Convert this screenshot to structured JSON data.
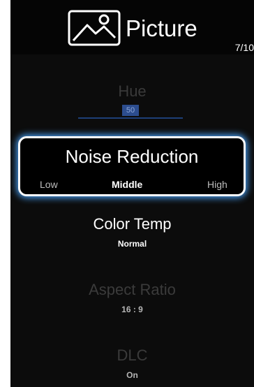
{
  "header": {
    "title": "Picture",
    "page_indicator": "7/10",
    "icon": "picture-icon"
  },
  "items": {
    "hue": {
      "label": "Hue",
      "value": "50"
    },
    "noise_reduction": {
      "label": "Noise Reduction",
      "options": [
        "Low",
        "Middle",
        "High"
      ],
      "selected": "Middle"
    },
    "color_temp": {
      "label": "Color Temp",
      "value": "Normal"
    },
    "aspect_ratio": {
      "label": "Aspect Ratio",
      "value": "16 : 9"
    },
    "dlc": {
      "label": "DLC",
      "value": "On"
    }
  },
  "colors": {
    "highlight": "#4aa6ff",
    "slider": "#2c4d8e",
    "background": "#0c0c0c"
  }
}
